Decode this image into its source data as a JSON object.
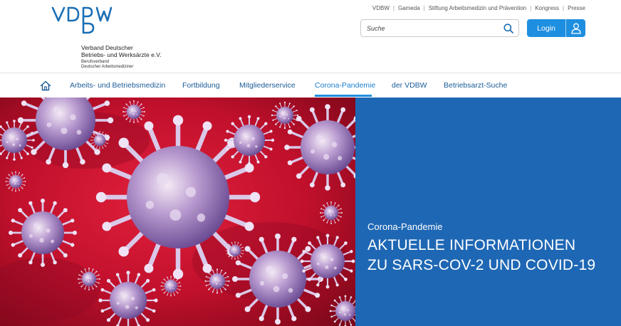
{
  "logo": {
    "mark": "VDBW",
    "line1": "Verband Deutscher",
    "line2": "Betriebs- und Werksärzte e.V.",
    "line3": "Berufsverband",
    "line4": "Deutscher Arbeitsmediziner"
  },
  "toplinks": [
    "VDBW",
    "Gameda",
    "Stiftung Arbeitsmedizin und Prävention",
    "Kongress",
    "Presse"
  ],
  "search": {
    "placeholder": "Suche",
    "value": ""
  },
  "login": {
    "label": "Login"
  },
  "nav": {
    "items": [
      {
        "label": "Arbeits- und Betriebsmedizin"
      },
      {
        "label": "Fortbildung"
      },
      {
        "label": "Mitgliederservice"
      },
      {
        "label": "Corona-Pandemie",
        "active": true
      },
      {
        "label": "der VDBW"
      },
      {
        "label": "Betriebsarzt-Suche"
      }
    ]
  },
  "hero": {
    "kicker": "Corona-Pandemie",
    "title_line1": "AKTUELLE INFORMATIONEN",
    "title_line2": "ZU SARS-COV-2 UND COVID-19"
  },
  "colors": {
    "brand_blue": "#1b6fb5",
    "nav_text": "#1a5b96",
    "accent": "#1e8fe0",
    "hero_panel": "#1e67b4",
    "virus_bg": "#c8102e"
  },
  "icons": {
    "home": "home-icon",
    "search": "search-icon",
    "user": "user-icon"
  }
}
